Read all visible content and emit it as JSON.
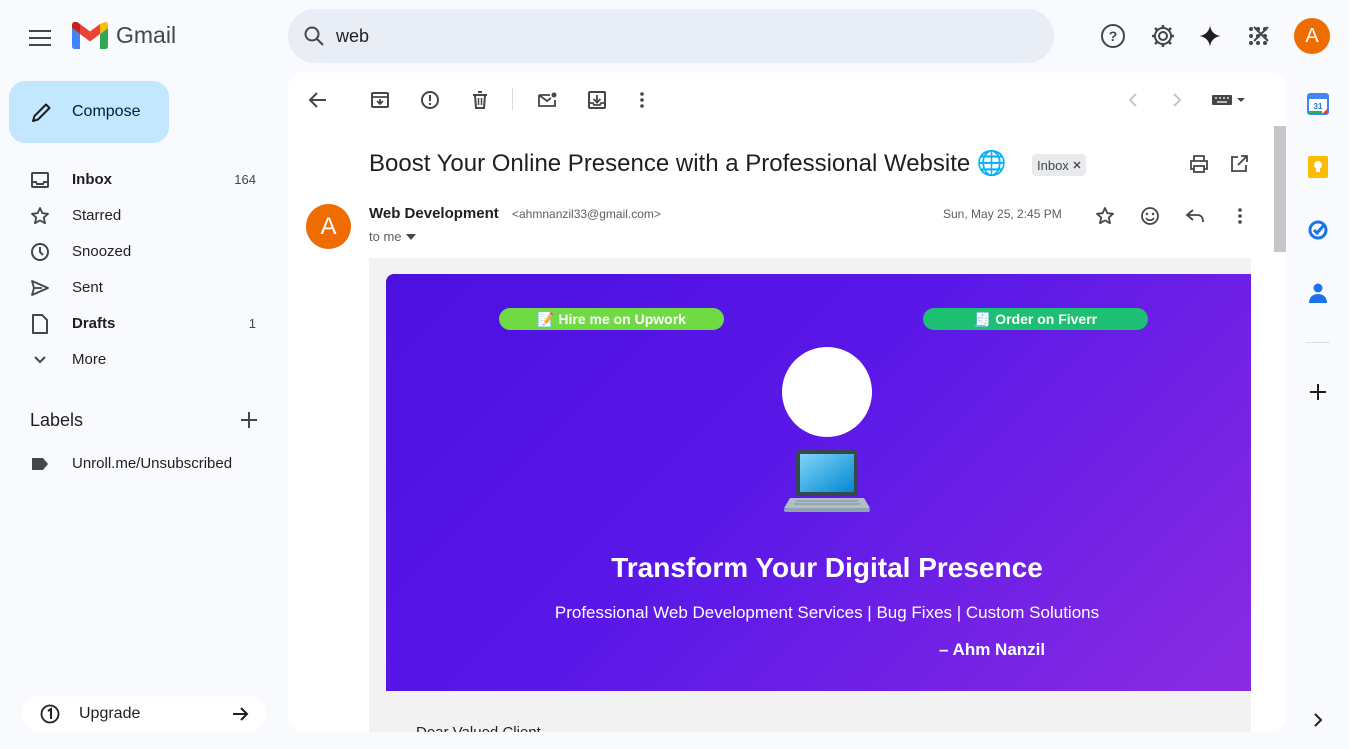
{
  "app": {
    "name": "Gmail"
  },
  "search": {
    "value": "web"
  },
  "account": {
    "initial": "A"
  },
  "compose": {
    "label": "Compose"
  },
  "nav": [
    {
      "label": "Inbox",
      "count": "164",
      "bold": true,
      "icon": "inbox-icon"
    },
    {
      "label": "Starred",
      "count": "",
      "bold": false,
      "icon": "star-icon"
    },
    {
      "label": "Snoozed",
      "count": "",
      "bold": false,
      "icon": "clock-icon"
    },
    {
      "label": "Sent",
      "count": "",
      "bold": false,
      "icon": "send-icon"
    },
    {
      "label": "Drafts",
      "count": "1",
      "bold": true,
      "icon": "draft-icon"
    },
    {
      "label": "More",
      "count": "",
      "bold": false,
      "icon": "chevron-down-icon"
    }
  ],
  "labels": {
    "heading": "Labels",
    "items": [
      {
        "label": "Unroll.me/Unsubscribed"
      }
    ]
  },
  "upgrade": {
    "label": "Upgrade"
  },
  "message": {
    "subject": "Boost Your Online Presence with a Professional Website 🌐",
    "chip": "Inbox",
    "sender_initial": "A",
    "sender_name": "Web Development",
    "sender_email": "<ahmnanzil33@gmail.com>",
    "to": "to me",
    "date": "Sun, May 25, 2:45 PM"
  },
  "email": {
    "upwork_label": "📝 Hire me on Upwork",
    "fiverr_label": "🧾 Order on Fiverr",
    "laptop": "💻",
    "headline": "Transform Your Digital Presence",
    "tagline": "Professional Web Development Services | Bug Fixes | Custom Solutions",
    "signature": "– Ahm Nanzil",
    "body_partial": "Dear Valued Client,"
  },
  "colors": {
    "accent": "#0b57d0",
    "compose_bg": "#c2e7ff",
    "avatar": "#ef6c00",
    "banner_start": "#4b10e0",
    "banner_end": "#8a2be2",
    "upwork": "#6fda44",
    "fiverr": "#1dbf73"
  }
}
